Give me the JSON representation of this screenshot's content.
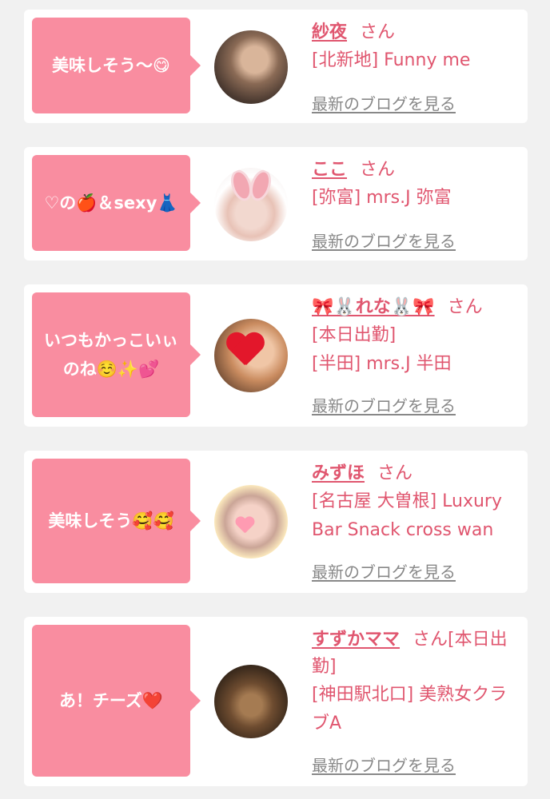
{
  "entries": [
    {
      "comment": "美味しそう〜😋",
      "name": "紗夜",
      "honorific": "さん",
      "shop_lines": [
        "[北新地] Funny me"
      ],
      "blog_link": "最新のブログを見る",
      "avatar_icon": "profile-photo"
    },
    {
      "comment": "♡の🍎＆sexy👗",
      "name": "ここ",
      "honorific": "さん",
      "shop_lines": [
        "[弥富] mrs.J 弥富"
      ],
      "blog_link": "最新のブログを見る",
      "avatar_icon": "profile-photo"
    },
    {
      "comment": "いつもかっこいぃのね☺️✨💕",
      "name": "🎀🐰れな🐰🎀",
      "honorific": "さん",
      "shop_lines": [
        "[本日出勤]",
        "[半田] mrs.J 半田"
      ],
      "blog_link": "最新のブログを見る",
      "avatar_icon": "profile-photo"
    },
    {
      "comment": "美味しそう🥰🥰",
      "name": "みずほ",
      "honorific": "さん",
      "shop_lines": [
        "[名古屋 大曽根] Luxury Bar Snack cross wan"
      ],
      "blog_link": "最新のブログを見る",
      "avatar_icon": "profile-photo"
    },
    {
      "comment": "あ！チーズ❤️",
      "name": "すずかママ",
      "honorific": "さん[本日出勤]",
      "shop_lines": [
        "[神田駅北口] 美熟女クラブA"
      ],
      "blog_link": "最新のブログを見る",
      "avatar_icon": "profile-photo"
    }
  ],
  "colors": {
    "accent_pink": "#f98da0",
    "text_pink": "#e0566f",
    "link_gray": "#888888",
    "background": "#f1f1f1"
  }
}
